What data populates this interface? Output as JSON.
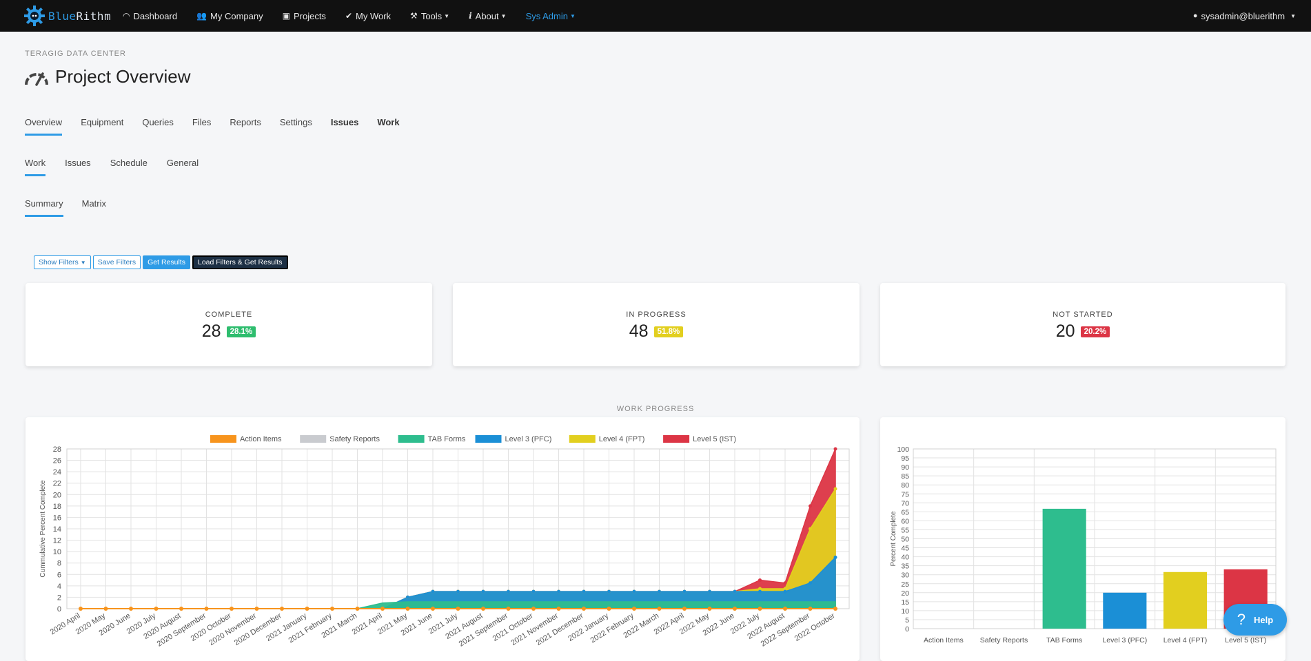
{
  "navbar": {
    "brand_part1": "Blue",
    "brand_part2": "Rithm",
    "items": [
      {
        "label": "Dashboard",
        "icon": "gauge-icon"
      },
      {
        "label": "My Company",
        "icon": "users-icon"
      },
      {
        "label": "Projects",
        "icon": "briefcase-icon"
      },
      {
        "label": "My Work",
        "icon": "check-icon"
      },
      {
        "label": "Tools",
        "icon": "wrench-icon"
      },
      {
        "label": "About",
        "icon": "info-icon"
      },
      {
        "label": "Sys Admin",
        "icon": ""
      }
    ],
    "user": "sysadmin@bluerithm"
  },
  "header": {
    "breadcrumb": "TERAGIG DATA CENTER",
    "title": "Project Overview"
  },
  "tabs_main": [
    "Overview",
    "Equipment",
    "Queries",
    "Files",
    "Reports",
    "Settings",
    "Issues",
    "Work"
  ],
  "tabs_sub": [
    "Work",
    "Issues",
    "Schedule",
    "General"
  ],
  "tabs_view": [
    "Summary",
    "Matrix"
  ],
  "filters": {
    "show_filters": "Show Filters",
    "save_filters": "Save Filters",
    "get_results": "Get Results",
    "load_filters": "Load Filters & Get Results"
  },
  "stats": [
    {
      "label": "COMPLETE",
      "value": "28",
      "percent": "28.1%",
      "color": "#2ebd6e"
    },
    {
      "label": "IN PROGRESS",
      "value": "48",
      "percent": "51.8%",
      "color": "#e2cf1f"
    },
    {
      "label": "NOT STARTED",
      "value": "20",
      "percent": "20.2%",
      "color": "#dc3545"
    }
  ],
  "section_label": "WORK PROGRESS",
  "help": {
    "label": "Help"
  },
  "chart_data": [
    {
      "type": "area",
      "title": "",
      "ylabel": "Cummulative Percent Complete",
      "xlabel": "",
      "ylim": [
        0,
        28
      ],
      "yticks": [
        0,
        2,
        4,
        6,
        8,
        10,
        12,
        14,
        16,
        18,
        20,
        22,
        24,
        26,
        28
      ],
      "grid": true,
      "legend_placement": "top",
      "x": [
        "2020 April",
        "2020 May",
        "2020 June",
        "2020 July",
        "2020 August",
        "2020 September",
        "2020 October",
        "2020 November",
        "2020 December",
        "2021 January",
        "2021 February",
        "2021 March",
        "2021 April",
        "2021 May",
        "2021 June",
        "2021 July",
        "2021 August",
        "2021 September",
        "2021 October",
        "2021 November",
        "2021 December",
        "2022 January",
        "2022 February",
        "2022 March",
        "2022 April",
        "2022 May",
        "2022 June",
        "2022 July",
        "2022 August",
        "2022 September",
        "2022 October"
      ],
      "series": [
        {
          "name": "Action Items",
          "color": "#f7941d",
          "values": [
            0,
            0,
            0,
            0,
            0,
            0,
            0,
            0,
            0,
            0,
            0,
            0,
            0,
            0,
            0,
            0,
            0,
            0,
            0,
            0,
            0,
            0,
            0,
            0,
            0,
            0,
            0,
            0,
            0,
            0,
            0
          ]
        },
        {
          "name": "Safety Reports",
          "color": "#c9cbcf",
          "values": [
            0,
            0,
            0,
            0,
            0,
            0,
            0,
            0,
            0,
            0,
            0,
            0,
            0,
            0,
            0,
            0,
            0,
            0,
            0,
            0,
            0,
            0,
            0,
            0,
            0,
            0,
            0,
            0,
            0,
            0,
            0
          ]
        },
        {
          "name": "TAB Forms",
          "color": "#2ebd8e",
          "values": [
            0,
            0,
            0,
            0,
            0,
            0,
            0,
            0,
            0,
            0,
            0,
            0,
            1,
            1.2,
            1.2,
            1.2,
            1.2,
            1.2,
            1.2,
            1.2,
            1.2,
            1.2,
            1.2,
            1.2,
            1.2,
            1.2,
            1.2,
            1.2,
            1.2,
            1.2,
            1.2
          ]
        },
        {
          "name": "Level 3 (PFC)",
          "color": "#1b8fd6",
          "values": [
            0,
            0,
            0,
            0,
            0,
            0,
            0,
            0,
            0,
            0,
            0,
            0,
            0,
            2,
            3,
            3,
            3,
            3,
            3,
            3,
            3,
            3,
            3,
            3,
            3,
            3,
            3,
            3,
            3,
            4.5,
            9
          ]
        },
        {
          "name": "Level 4 (FPT)",
          "color": "#e2cf1f",
          "values": [
            0,
            0,
            0,
            0,
            0,
            0,
            0,
            0,
            0,
            0,
            0,
            0,
            0,
            2,
            3,
            3,
            3,
            3,
            3,
            3,
            3,
            3,
            3,
            3,
            3,
            3,
            3,
            3.5,
            3.5,
            14,
            21
          ]
        },
        {
          "name": "Level 5 (IST)",
          "color": "#dc3545",
          "values": [
            0,
            0,
            0,
            0,
            0,
            0,
            0,
            0,
            0,
            0,
            0,
            0,
            0,
            2,
            3,
            3,
            3,
            3,
            3,
            3,
            3,
            3,
            3,
            3,
            3,
            3,
            3,
            5,
            4.5,
            18,
            28
          ]
        }
      ]
    },
    {
      "type": "bar",
      "title": "",
      "ylabel": "Percent Complete",
      "xlabel": "",
      "ylim": [
        0,
        100
      ],
      "yticks": [
        0,
        5,
        10,
        15,
        20,
        25,
        30,
        35,
        40,
        45,
        50,
        55,
        60,
        65,
        70,
        75,
        80,
        85,
        90,
        95,
        100
      ],
      "grid": true,
      "categories": [
        "Action Items",
        "Safety Reports",
        "TAB Forms",
        "Level 3 (PFC)",
        "Level 4 (FPT)",
        "Level 5 (IST)"
      ],
      "values": [
        0,
        0,
        66.7,
        20,
        31.5,
        33
      ],
      "colors": [
        "#f7941d",
        "#c9cbcf",
        "#2ebd8e",
        "#1b8fd6",
        "#e2cf1f",
        "#dc3545"
      ]
    }
  ]
}
